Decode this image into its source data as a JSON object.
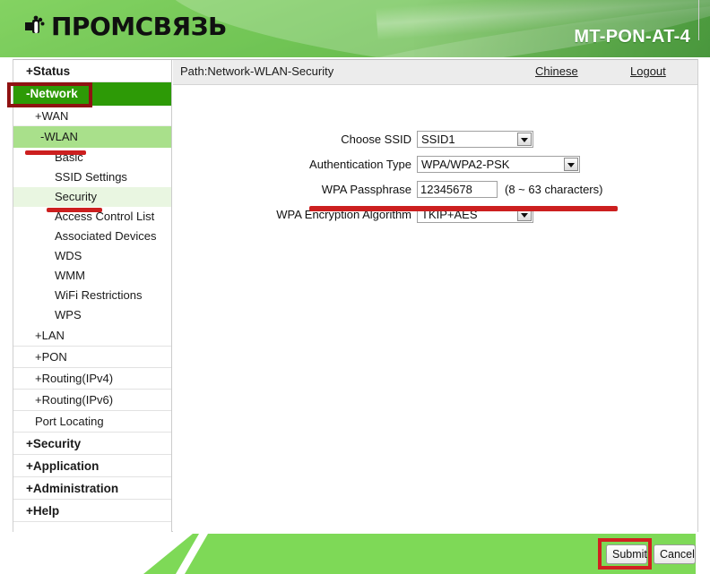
{
  "header": {
    "logo_text": "ПРОМСВЯЗЬ",
    "logo_icon": "plug-connector-icon",
    "model_name": "MT-PON-AT-4"
  },
  "sidebar": {
    "items": [
      {
        "label": "+Status",
        "type": "top"
      },
      {
        "label": "-Network",
        "type": "top-active"
      },
      {
        "label": "+WAN",
        "type": "sub"
      },
      {
        "label": "-WLAN",
        "type": "sub-open"
      },
      {
        "label": "Basic",
        "type": "leaf"
      },
      {
        "label": "SSID Settings",
        "type": "leaf"
      },
      {
        "label": "Security",
        "type": "leaf-active"
      },
      {
        "label": "Access Control List",
        "type": "leaf"
      },
      {
        "label": "Associated Devices",
        "type": "leaf"
      },
      {
        "label": "WDS",
        "type": "leaf"
      },
      {
        "label": "WMM",
        "type": "leaf"
      },
      {
        "label": "WiFi Restrictions",
        "type": "leaf"
      },
      {
        "label": "WPS",
        "type": "leaf"
      },
      {
        "label": "+LAN",
        "type": "sub"
      },
      {
        "label": "+PON",
        "type": "sub"
      },
      {
        "label": "+Routing(IPv4)",
        "type": "sub"
      },
      {
        "label": "+Routing(IPv6)",
        "type": "sub"
      },
      {
        "label": "Port Locating",
        "type": "plain"
      },
      {
        "label": "+Security",
        "type": "top"
      },
      {
        "label": "+Application",
        "type": "top"
      },
      {
        "label": "+Administration",
        "type": "top"
      },
      {
        "label": "+Help",
        "type": "top"
      }
    ]
  },
  "pathbar": {
    "path": "Path:Network-WLAN-Security",
    "chinese_link": "Chinese",
    "logout_link": "Logout"
  },
  "form": {
    "choose_ssid": {
      "label": "Choose SSID",
      "value": "SSID1"
    },
    "authentication_type": {
      "label": "Authentication Type",
      "value": "WPA/WPA2-PSK"
    },
    "wpa_passphrase": {
      "label": "WPA Passphrase",
      "value": "12345678",
      "hint": "(8 ~ 63 characters)"
    },
    "wpa_encryption_algorithm": {
      "label": "WPA Encryption Algorithm",
      "value": "TKIP+AES"
    }
  },
  "footer": {
    "submit_label": "Submit",
    "cancel_label": "Cancel"
  },
  "colors": {
    "header_green": "#3aae14",
    "nav_active_green": "#2d9a06",
    "nav_open_green": "#a9e08b",
    "nav_leaf_green": "#e9f6e1",
    "footer_green": "#7ed957",
    "annotation_red": "#cc1f1f",
    "annotation_dark_red": "#8f1212"
  }
}
